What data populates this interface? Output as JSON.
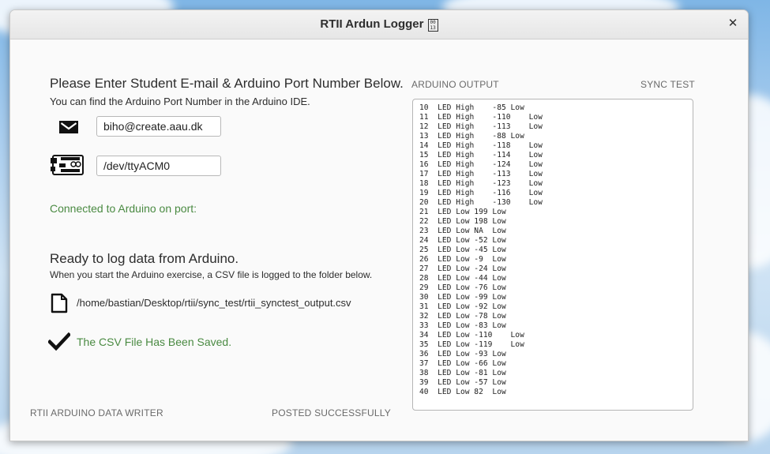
{
  "window": {
    "title": "RTII Ardun Logger",
    "title_glyph": "0013",
    "close_label": "✕"
  },
  "form": {
    "heading": "Please Enter Student E-mail & Arduino Port Number Below.",
    "hint": "You can find the Arduino Port Number in the Arduino IDE.",
    "email_value": "biho@create.aau.dk",
    "port_value": "/dev/ttyACM0",
    "connection_status": "Connected to Arduino on port:"
  },
  "log": {
    "heading": "Ready to log data from Arduino.",
    "description": "When you start the Arduino exercise, a CSV file is logged to the folder below.",
    "file_path": "/home/bastian/Desktop/rtii/sync_test/rtii_synctest_output.csv",
    "saved_status": "The CSV File Has Been Saved."
  },
  "footer": {
    "app_name": "RTII ARDUINO DATA WRITER",
    "post_status": "POSTED SUCCESSFULLY"
  },
  "output_panel": {
    "label": "ARDUINO OUTPUT",
    "sync_label": "SYNC TEST",
    "lines": [
      "10  LED High    -85 Low",
      "11  LED High    -110    Low",
      "12  LED High    -113    Low",
      "13  LED High    -88 Low",
      "14  LED High    -118    Low",
      "15  LED High    -114    Low",
      "16  LED High    -124    Low",
      "17  LED High    -113    Low",
      "18  LED High    -123    Low",
      "19  LED High    -116    Low",
      "20  LED High    -130    Low",
      "21  LED Low 199 Low",
      "22  LED Low 198 Low",
      "23  LED Low NA  Low",
      "24  LED Low -52 Low",
      "25  LED Low -45 Low",
      "26  LED Low -9  Low",
      "27  LED Low -24 Low",
      "28  LED Low -44 Low",
      "29  LED Low -76 Low",
      "30  LED Low -99 Low",
      "31  LED Low -92 Low",
      "32  LED Low -78 Low",
      "33  LED Low -83 Low",
      "34  LED Low -110    Low",
      "35  LED Low -119    Low",
      "36  LED Low -93 Low",
      "37  LED Low -66 Low",
      "38  LED Low -81 Low",
      "39  LED Low -57 Low",
      "40  LED Low 82  Low"
    ]
  },
  "icons": {
    "email": "envelope-icon",
    "arduino": "arduino-board-icon",
    "file": "document-icon",
    "saved": "checkmark-icon"
  }
}
